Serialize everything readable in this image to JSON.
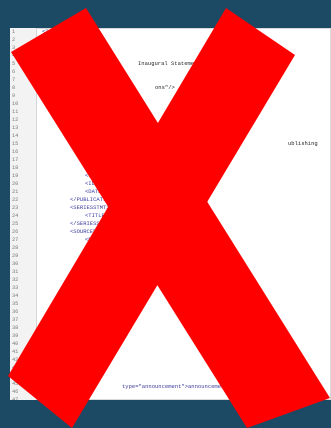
{
  "editor": {
    "line_numbers": [
      "1",
      "2",
      "3",
      "4",
      "5",
      "6",
      "7",
      "8",
      "9",
      "10",
      "11",
      "12",
      "13",
      "14",
      "15",
      "16",
      "17",
      "18",
      "19",
      "20",
      "21",
      "22",
      "23",
      "24",
      "25",
      "26",
      "27",
      "28",
      "29",
      "30",
      "31",
      "32",
      "33",
      "34",
      "35",
      "36",
      "37",
      "38",
      "39",
      "40",
      "41",
      "42",
      "43",
      "44",
      "45",
      "46",
      "47"
    ],
    "visible_snippets": [
      "<?xml",
      "<D",
      "Inaugural Statement",
      "ons\"/>",
      "ublishing",
      "<",
      "<ID",
      "<ID",
      "<DATE",
      "</PUBLICATI",
      "<SERIESSTMT>",
      "<TITLE>The",
      "</SERIESSTMT>",
      "<SOURCEDESC>",
      "<BIBL>",
      "type=\"announcement\">announcement</TERM>"
    ]
  },
  "overlay": {
    "symbol_name": "red-x",
    "color": "#ff0000"
  }
}
